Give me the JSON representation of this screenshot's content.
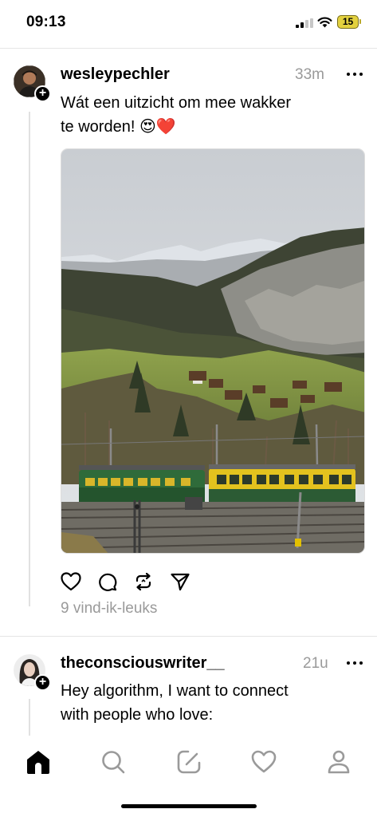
{
  "status_bar": {
    "time": "09:13",
    "battery": "15",
    "battery_color": "#e3d13f"
  },
  "posts": [
    {
      "username": "wesleypechler",
      "time": "33m",
      "text_line1": "Wát een uitzicht om mee wakker",
      "text_line2": "te worden! 😍❤️",
      "likes": "9 vind-ik-leuks",
      "image": "mountain-valley-train-photo"
    },
    {
      "username": "theconsciouswriter__",
      "time": "21u",
      "text_line1": "Hey algorithm, I want to connect",
      "text_line2": "with people who love:"
    }
  ],
  "actions": [
    "heart-icon",
    "comment-icon",
    "repost-icon",
    "share-icon"
  ],
  "bottom_nav": [
    "home-icon",
    "search-icon",
    "compose-icon",
    "activity-icon",
    "profile-icon"
  ]
}
